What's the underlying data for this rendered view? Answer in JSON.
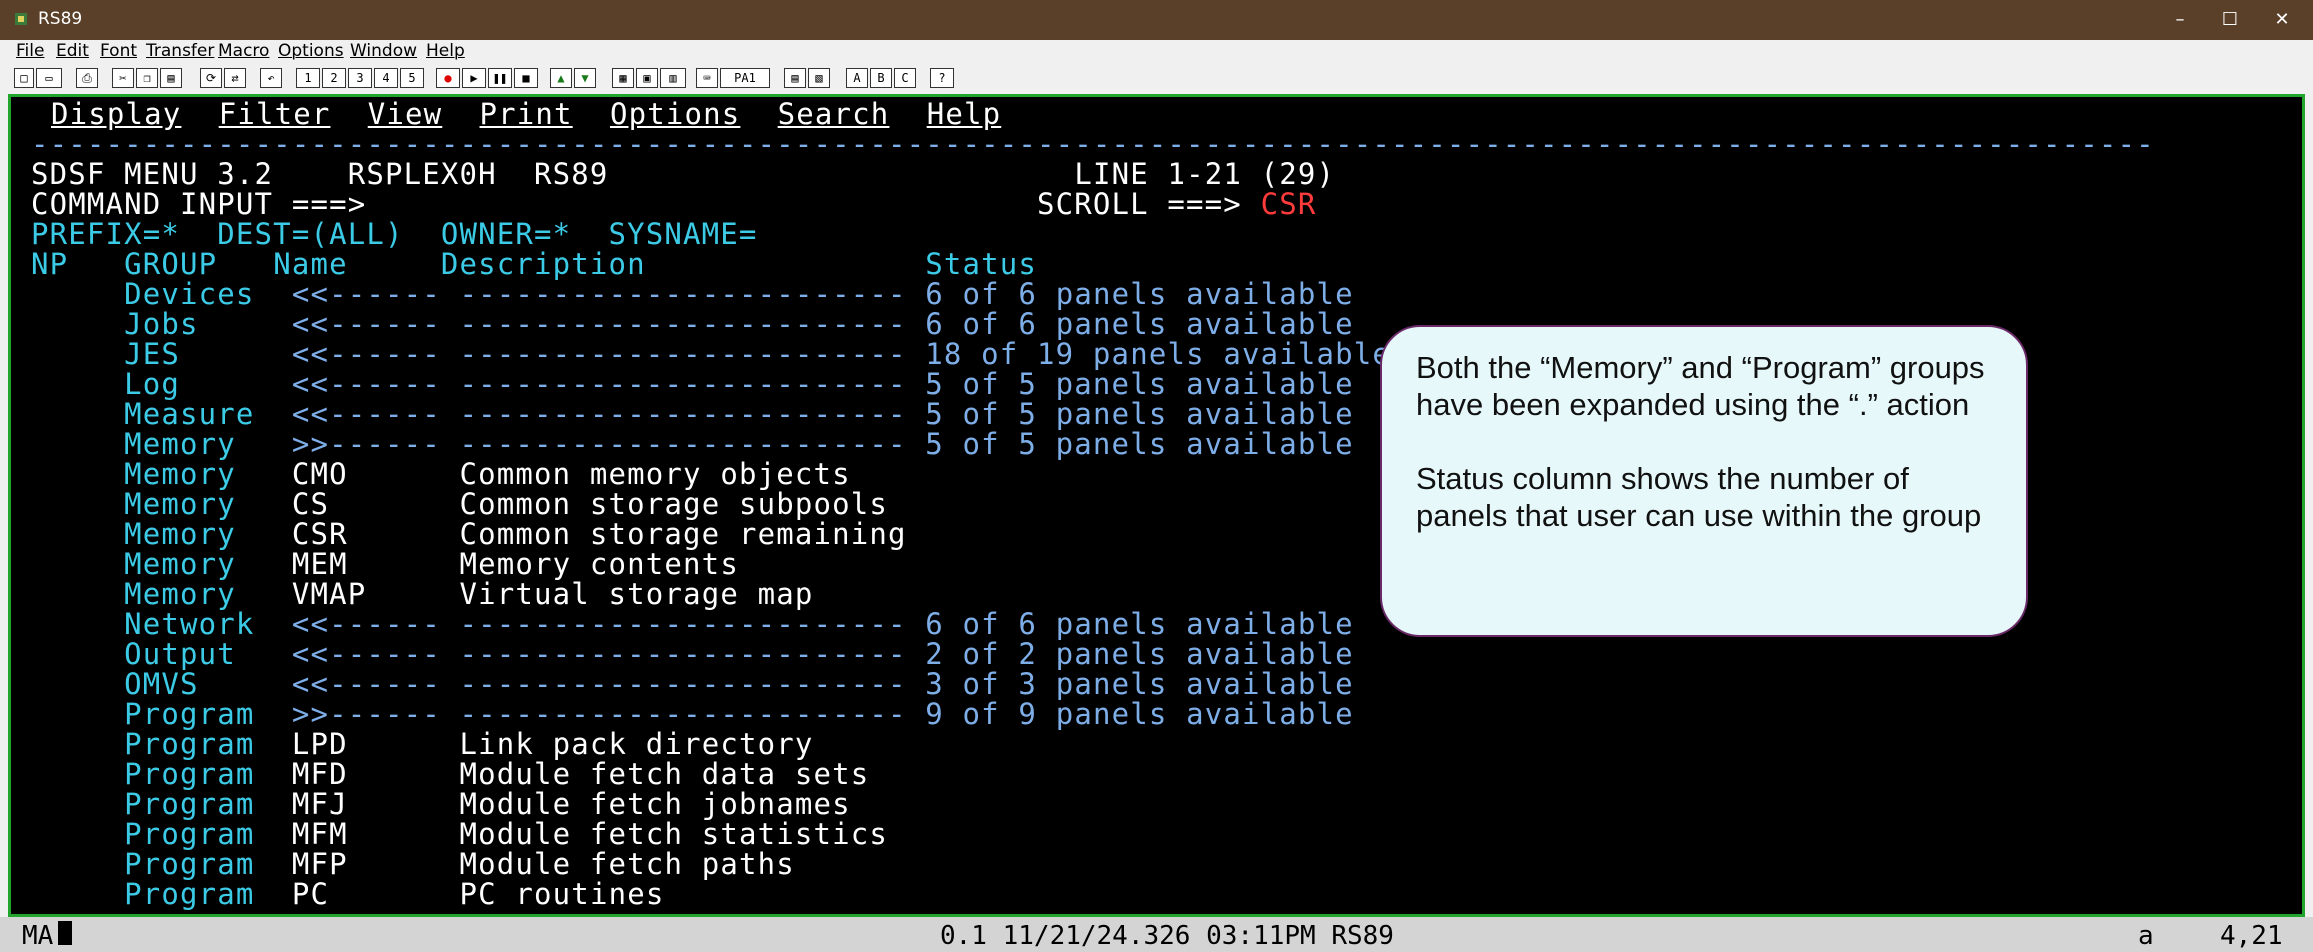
{
  "window": {
    "title": "RS89",
    "controls": {
      "minimize": "–",
      "maximize": "☐",
      "close": "✕"
    }
  },
  "menubar": [
    "File",
    "Edit",
    "Font",
    "Transfer",
    "Macro",
    "Options",
    "Window",
    "Help"
  ],
  "toolbar": {
    "buttons": [
      "1",
      "2",
      "3",
      "4",
      "5"
    ],
    "pa1": "PA1",
    "abc": [
      "A",
      "B",
      "C"
    ],
    "help": "?"
  },
  "terminal": {
    "action_bar": [
      "Display",
      "Filter",
      "View",
      "Print",
      "Options",
      "Search",
      "Help"
    ],
    "separator": "------------------------------------------------------------------------------------------------------------------",
    "header": {
      "title": "SDSF MENU 3.2",
      "plex": "RSPLEX0H",
      "system": "RS89",
      "line_info": "LINE 1-21 (29)",
      "command_label": "COMMAND INPUT ===>",
      "scroll_label": "SCROLL ===>",
      "scroll_value": "CSR"
    },
    "filters": "PREFIX=*  DEST=(ALL)  OWNER=*  SYSNAME=",
    "columns": {
      "np": "NP",
      "group": "GROUP",
      "name": "Name",
      "description": "Description",
      "status": "Status"
    },
    "rows": [
      {
        "group": "Devices",
        "name": "<<------",
        "description": "------------------------",
        "status": "6 of 6 panels available",
        "kind": "group"
      },
      {
        "group": "Jobs",
        "name": "<<------",
        "description": "------------------------",
        "status": "6 of 6 panels available",
        "kind": "group"
      },
      {
        "group": "JES",
        "name": "<<------",
        "description": "------------------------",
        "status": "18 of 19 panels available",
        "kind": "group"
      },
      {
        "group": "Log",
        "name": "<<------",
        "description": "------------------------",
        "status": "5 of 5 panels available",
        "kind": "group"
      },
      {
        "group": "Measure",
        "name": "<<------",
        "description": "------------------------",
        "status": "5 of 5 panels available",
        "kind": "group"
      },
      {
        "group": "Memory",
        "name": ">>------",
        "description": "------------------------",
        "status": "5 of 5 panels available",
        "kind": "group"
      },
      {
        "group": "Memory",
        "name": "CMO",
        "description": "Common memory objects",
        "status": "",
        "kind": "panel"
      },
      {
        "group": "Memory",
        "name": "CS",
        "description": "Common storage subpools",
        "status": "",
        "kind": "panel"
      },
      {
        "group": "Memory",
        "name": "CSR",
        "description": "Common storage remaining",
        "status": "",
        "kind": "panel"
      },
      {
        "group": "Memory",
        "name": "MEM",
        "description": "Memory contents",
        "status": "",
        "kind": "panel"
      },
      {
        "group": "Memory",
        "name": "VMAP",
        "description": "Virtual storage map",
        "status": "",
        "kind": "panel"
      },
      {
        "group": "Network",
        "name": "<<------",
        "description": "------------------------",
        "status": "6 of 6 panels available",
        "kind": "group"
      },
      {
        "group": "Output",
        "name": "<<------",
        "description": "------------------------",
        "status": "2 of 2 panels available",
        "kind": "group"
      },
      {
        "group": "OMVS",
        "name": "<<------",
        "description": "------------------------",
        "status": "3 of 3 panels available",
        "kind": "group"
      },
      {
        "group": "Program",
        "name": ">>------",
        "description": "------------------------",
        "status": "9 of 9 panels available",
        "kind": "group"
      },
      {
        "group": "Program",
        "name": "LPD",
        "description": "Link pack directory",
        "status": "",
        "kind": "panel"
      },
      {
        "group": "Program",
        "name": "MFD",
        "description": "Module fetch data sets",
        "status": "",
        "kind": "panel"
      },
      {
        "group": "Program",
        "name": "MFJ",
        "description": "Module fetch jobnames",
        "status": "",
        "kind": "panel"
      },
      {
        "group": "Program",
        "name": "MFM",
        "description": "Module fetch statistics",
        "status": "",
        "kind": "panel"
      },
      {
        "group": "Program",
        "name": "MFP",
        "description": "Module fetch paths",
        "status": "",
        "kind": "panel"
      },
      {
        "group": "Program",
        "name": "PC",
        "description": "PC routines",
        "status": "",
        "kind": "panel"
      }
    ]
  },
  "callout": {
    "line1": "Both the “Memory” and “Program” groups have been expanded using the “.” action",
    "line2": "Status column shows the number of panels that user can use within the group"
  },
  "statusbar": {
    "mode": "MA",
    "center": "0.1 11/21/24.326 03:11PM RS89",
    "session": "a",
    "cursor": "4,21"
  },
  "colors": {
    "frame": "#22a52d",
    "titlebar": "#5b4029",
    "cyan": "#3ccbe6",
    "blue": "#7eaee8",
    "red": "#ff3b3b"
  }
}
